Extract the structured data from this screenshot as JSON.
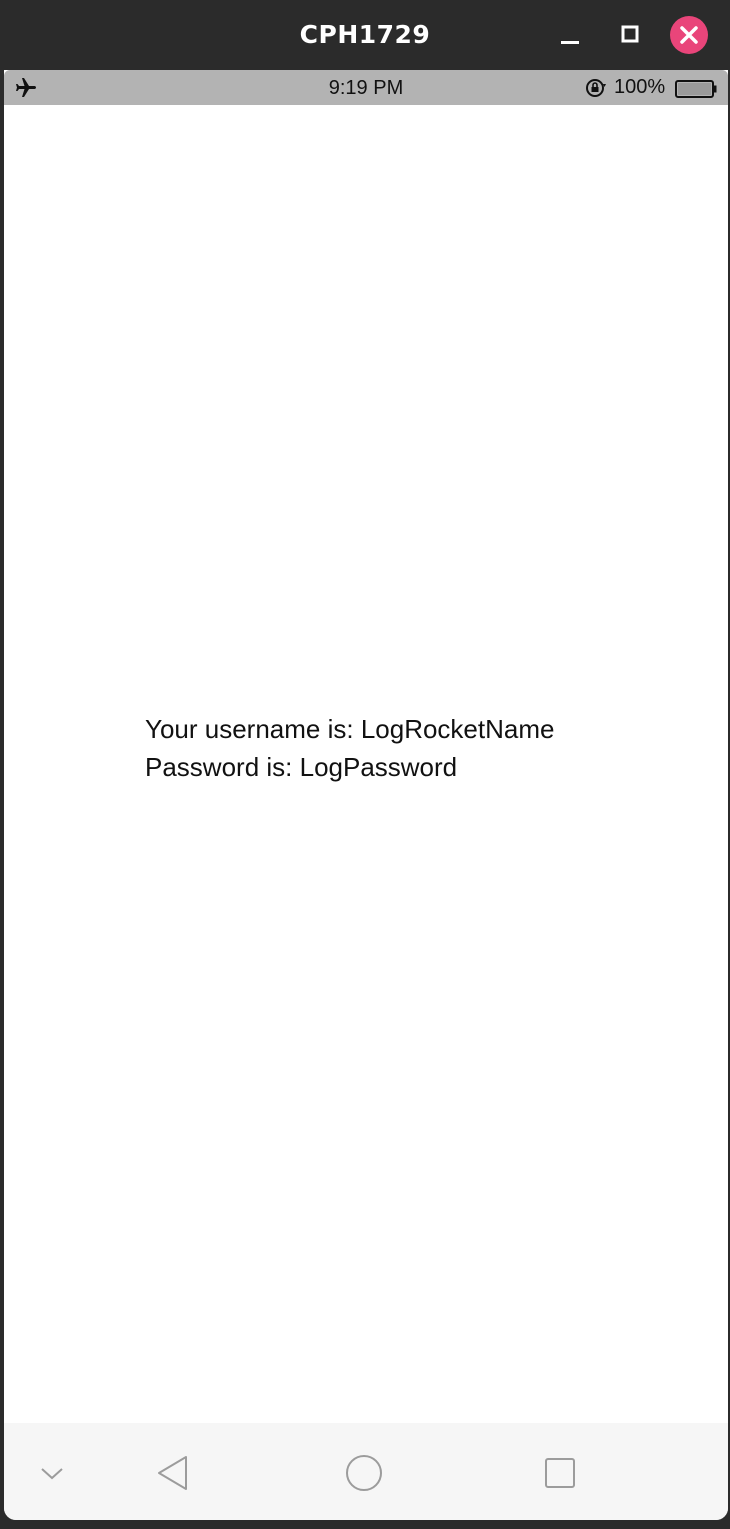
{
  "window": {
    "title": "CPH1729",
    "controls": {
      "minimize_icon": "minimize-icon",
      "maximize_icon": "maximize-icon",
      "close_icon": "close-icon",
      "close_color": "#e9457a"
    }
  },
  "statusbar": {
    "time": "9:19 PM",
    "battery_percent": "100%",
    "icons": [
      "airplane-mode-icon",
      "rotation-lock-icon",
      "battery-icon"
    ],
    "background": "#b3b3b3"
  },
  "main": {
    "username_line": "Your username is: LogRocketName",
    "password_line": "Password is: LogPassword"
  },
  "navbar": {
    "icons": [
      "chevron-down-icon",
      "back-icon",
      "home-icon",
      "recent-apps-icon"
    ]
  }
}
